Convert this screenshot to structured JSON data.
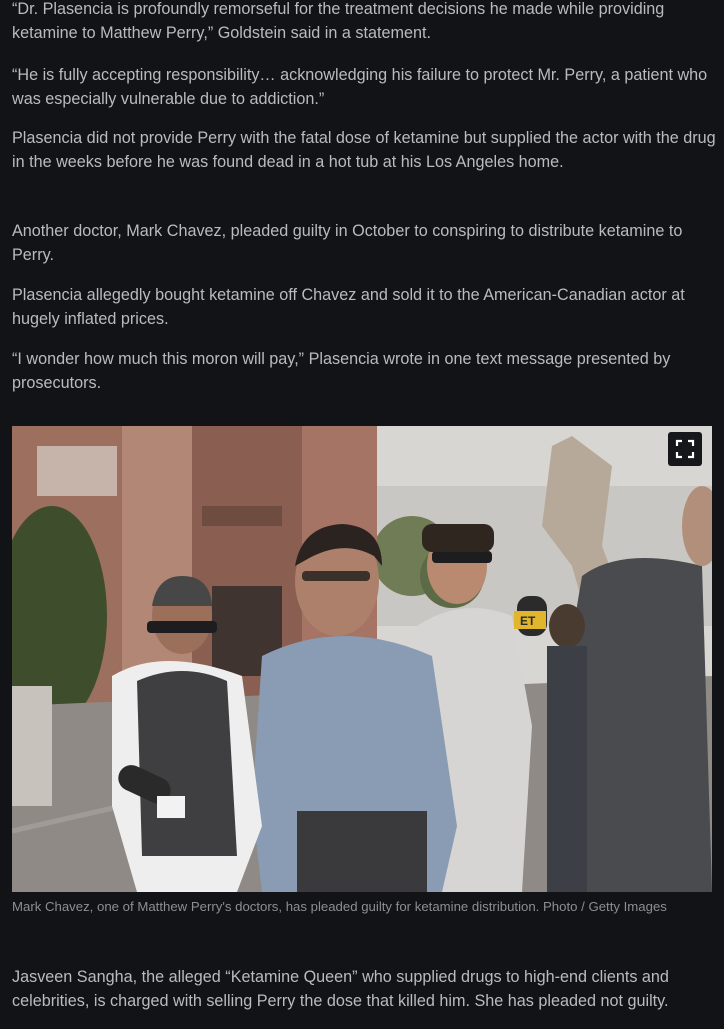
{
  "article": {
    "paragraphs": [
      "“Dr. Plasencia is profoundly remorseful for the treatment decisions he made while providing ketamine to Matthew Perry,” Goldstein said in a statement.",
      "“He is fully accepting responsibility… acknowledging his failure to protect Mr. Perry, a patient who was especially vulnerable due to addiction.”",
      "Plasencia did not provide Perry with the fatal dose of ketamine but supplied the actor with the drug in the weeks before he was found dead in a hot tub at his Los Angeles home.",
      "Another doctor, Mark Chavez, pleaded guilty in October to conspiring to distribute ketamine to Perry.",
      "Plasencia allegedly bought ketamine off Chavez and sold it to the American-Canadian actor at hugely inflated prices.",
      "“I wonder how much this moron will pay,” Plasencia wrote in one text message presented by prosecutors.",
      "Jasveen Sangha, the alleged “Ketamine Queen” who supplied drugs to high-end clients and celebrities, is charged with selling Perry the dose that killed him. She has pleaded not guilty."
    ],
    "figure": {
      "expand_icon": "fullscreen-expand-icon",
      "caption": "Mark Chavez, one of Matthew Perry's doctors, has pleaded guilty for ketamine distribution. Photo / Getty Images",
      "microphone_logo_text": "ET"
    }
  },
  "colors": {
    "background": "#121316",
    "body_text": "#b9bbbf",
    "caption_text": "#8b8e93",
    "expand_button_bg": "#16171a"
  }
}
